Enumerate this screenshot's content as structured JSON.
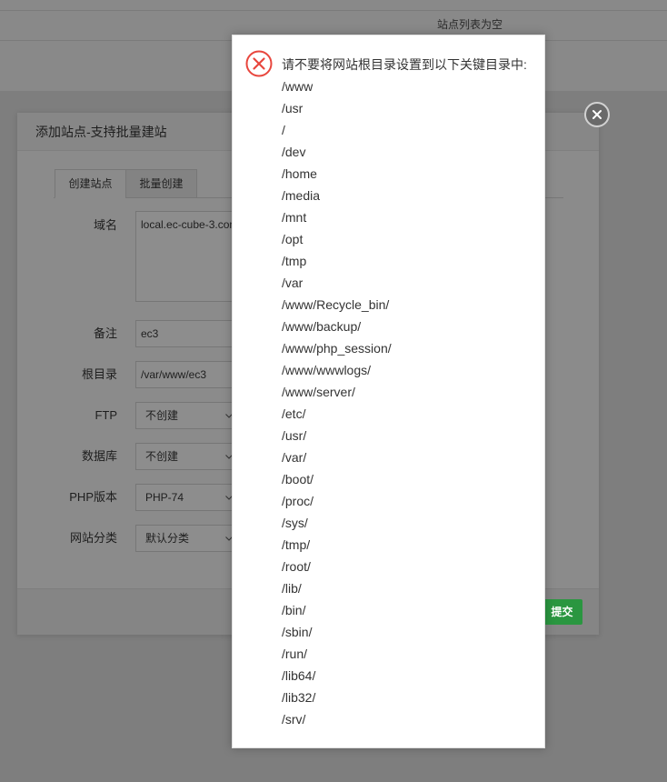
{
  "page": {
    "empty_list_text": "站点列表为空"
  },
  "dialog": {
    "title": "添加站点-支持批量建站",
    "close_icon": "close-icon",
    "tabs": [
      {
        "label": "创建站点",
        "active": true
      },
      {
        "label": "批量创建",
        "active": false
      }
    ],
    "form": {
      "domain": {
        "label": "域名",
        "value": "local.ec-cube-3.com"
      },
      "remark": {
        "label": "备注",
        "value": "ec3"
      },
      "root_dir": {
        "label": "根目录",
        "value": "/var/www/ec3"
      },
      "ftp": {
        "label": "FTP",
        "value": "不创建"
      },
      "database": {
        "label": "数据库",
        "value": "不创建"
      },
      "php_version": {
        "label": "PHP版本",
        "value": "PHP-74"
      },
      "site_category": {
        "label": "网站分类",
        "value": "默认分类"
      }
    },
    "submit_label": "提交"
  },
  "alert": {
    "icon": "error-circle-x-icon",
    "message": "请不要将网站根目录设置到以下关键目录中:",
    "paths": [
      "/www",
      "/usr",
      "/",
      "/dev",
      "/home",
      "/media",
      "/mnt",
      "/opt",
      "/tmp",
      "/var",
      "/www/Recycle_bin/",
      "/www/backup/",
      "/www/php_session/",
      "/www/wwwlogs/",
      "/www/server/",
      "/etc/",
      "/usr/",
      "/var/",
      "/boot/",
      "/proc/",
      "/sys/",
      "/tmp/",
      "/root/",
      "/lib/",
      "/bin/",
      "/sbin/",
      "/run/",
      "/lib64/",
      "/lib32/",
      "/srv/"
    ]
  },
  "colors": {
    "accent_green": "#20a53a",
    "error_red": "#e8463d"
  }
}
